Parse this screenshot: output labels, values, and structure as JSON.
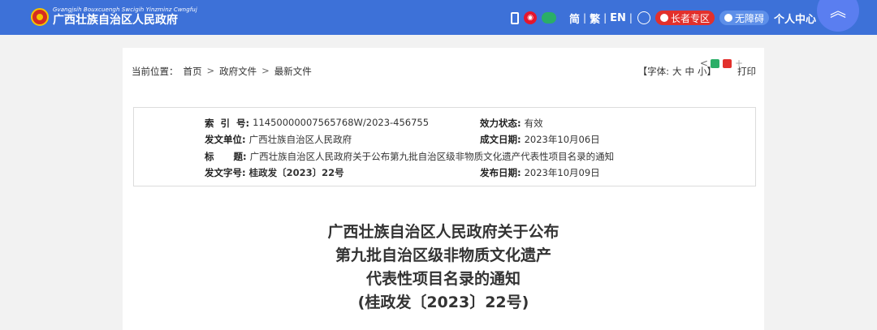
{
  "header": {
    "logo_pinyin": "Gvangjsih Bouxcuengh Swcigih Yinzminz Cwngfuj",
    "logo_text": "广西壮族自治区人民政府",
    "lang_simplified": "简",
    "lang_sep1": "|",
    "lang_traditional": "繁",
    "lang_sep2": "|",
    "lang_english": "EN",
    "lang_sep3": "|",
    "elder_zone": "长者专区",
    "accessibility": "无障碍",
    "personal_center": "个人中心",
    "icons": [
      "phone-icon",
      "weibo-icon",
      "wechat-icon",
      "globe-icon",
      "back-to-top-icon"
    ],
    "colors": {
      "bar": "#3d71d8",
      "elder": "#e2302c",
      "access": "#5d8fe9"
    }
  },
  "breadcrumb": {
    "prefix": "当前位置：",
    "items": [
      "首页",
      "政府文件",
      "最新文件"
    ],
    "sep": ">"
  },
  "tools": {
    "font_label": "【字体:",
    "font_large": "大",
    "font_medium": "中",
    "font_small": "小】",
    "print": "打印"
  },
  "meta": {
    "index_label": "索  引  号:",
    "index_value": "11450000007565768W/2023-456755",
    "status_label": "效力状态:",
    "status_value": "有效",
    "issuer_label": "发文单位:",
    "issuer_value": "广西壮族自治区人民政府",
    "created_label": "成文日期:",
    "created_value": "2023年10月06日",
    "subject_label": "标      题:",
    "subject_value": "广西壮族自治区人民政府关于公布第九批自治区级非物质文化遗产代表性项目名录的通知",
    "docno_label": "发文字号:",
    "docno_value": "桂政发〔2023〕22号",
    "published_label": "发布日期:",
    "published_value": "2023年10月09日"
  },
  "doc_title": {
    "line1": "广西壮族自治区人民政府关于公布",
    "line2": "第九批自治区级非物质文化遗产",
    "line3": "代表性项目名录的通知",
    "line4": "(桂政发〔2023〕22号)"
  }
}
